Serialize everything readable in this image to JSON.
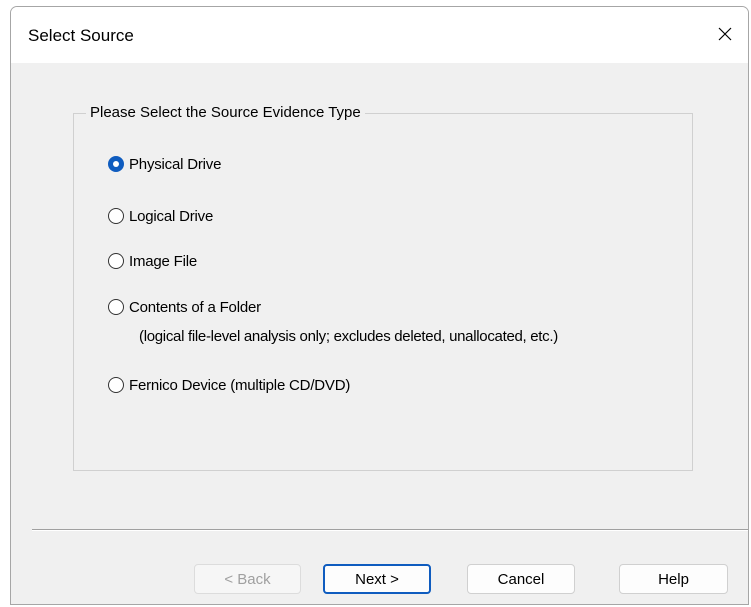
{
  "dialog": {
    "title": "Select Source",
    "close_icon": "close-icon"
  },
  "group": {
    "label": "Please Select the Source Evidence Type",
    "options": [
      {
        "label": "Physical Drive",
        "checked": true
      },
      {
        "label": "Logical Drive",
        "checked": false
      },
      {
        "label": "Image File",
        "checked": false
      },
      {
        "label": "Contents of a Folder",
        "checked": false
      },
      {
        "label": "Fernico Device (multiple CD/DVD)",
        "checked": false
      }
    ],
    "folder_note": "(logical file-level analysis only; excludes deleted, unallocated, etc.)"
  },
  "buttons": {
    "back": "< Back",
    "next": "Next >",
    "cancel": "Cancel",
    "help": "Help"
  },
  "colors": {
    "accent": "#0f5cbf",
    "disabled_text": "#a0a0a0"
  }
}
